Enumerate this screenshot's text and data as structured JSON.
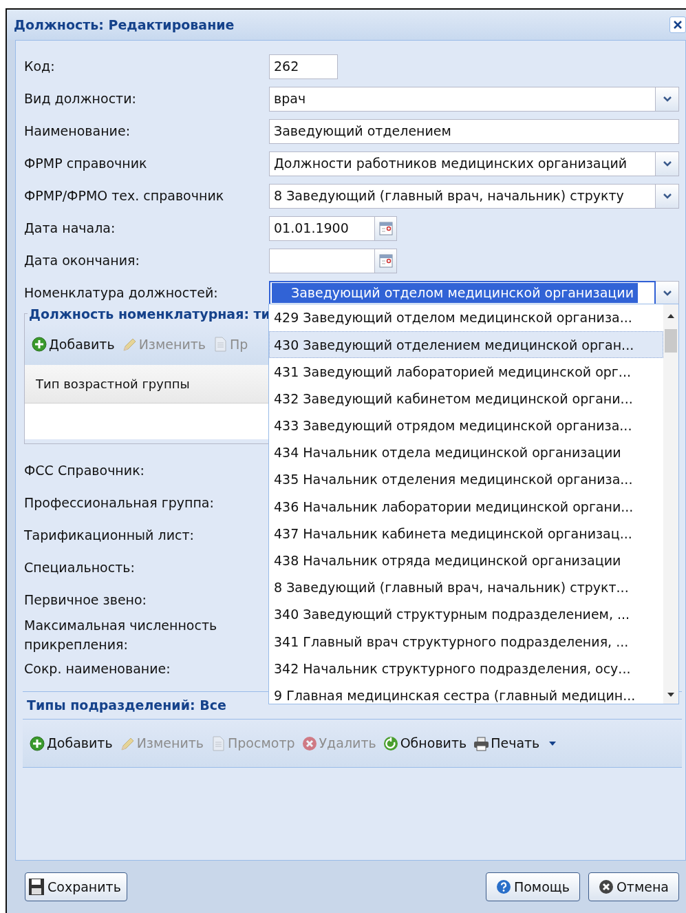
{
  "dialog": {
    "title": "Должность: Редактирование"
  },
  "fields": [
    {
      "label": "Код:",
      "kind": "short_text",
      "value": "262",
      "focused": false
    },
    {
      "label": "Вид должности:",
      "kind": "combo",
      "value": "врач",
      "focused": false
    },
    {
      "label": "Наименование:",
      "kind": "text",
      "value": "Заведующий отделением",
      "focused": false
    },
    {
      "label": "ФРМР справочник",
      "kind": "combo",
      "value": "Должности работников медицинских организаций",
      "focused": false
    },
    {
      "label": "ФРМР/ФРМО тех. справочник",
      "kind": "combo",
      "value": "8 Заведующий (главный врач, начальник) структу",
      "focused": false
    },
    {
      "label": "Дата начала:",
      "kind": "date",
      "value": "01.01.1900",
      "focused": false
    },
    {
      "label": "Дата окончания:",
      "kind": "date",
      "focused": false
    },
    {
      "label": "Номенклатура должностей:",
      "kind": "combo",
      "value": "Заведующий отделом медицинской организации",
      "focused": true
    }
  ],
  "nomenclature_panel": {
    "title": "Должность номенклатурная: ти",
    "toolbar": [
      {
        "label": "Добавить",
        "kind": "add",
        "disabled": false
      },
      {
        "label": "Изменить",
        "kind": "edit",
        "disabled": true
      },
      {
        "label": "Пр",
        "kind": "view",
        "disabled": true
      }
    ],
    "columns": [
      "Тип возрастной группы"
    ]
  },
  "more_labels": [
    "ФСС Справочник:",
    "Профессиональная группа:",
    "Тарификационный лист:",
    "Специальность:",
    "Первичное звено:",
    "Максимальная численность прикрепления:",
    "Сокр. наименование:"
  ],
  "dropdown": {
    "items": [
      {
        "text": "429 Заведующий отделом медицинской организа...",
        "selected": false
      },
      {
        "text": "430 Заведующий отделением медицинской орган...",
        "selected": true
      },
      {
        "text": "431 Заведующий лабораторией медицинской орг...",
        "selected": false
      },
      {
        "text": "432 Заведующий кабинетом медицинской органи...",
        "selected": false
      },
      {
        "text": "433 Заведующий отрядом медицинской организа...",
        "selected": false
      },
      {
        "text": "434 Начальник отдела медицинской организации",
        "selected": false
      },
      {
        "text": "435 Начальник отделения медицинской организа...",
        "selected": false
      },
      {
        "text": "436 Начальник лаборатории медицинской органи...",
        "selected": false
      },
      {
        "text": "437 Начальник кабинета медицинской организац...",
        "selected": false
      },
      {
        "text": "438 Начальник отряда медицинской организации",
        "selected": false
      },
      {
        "text": "8 Заведующий (главный врач, начальник) структ...",
        "selected": false
      },
      {
        "text": "340 Заведующий структурным подразделением, ...",
        "selected": false
      },
      {
        "text": "341 Главный врач структурного подразделения, ...",
        "selected": false
      },
      {
        "text": "342 Начальник структурного подразделения, осу...",
        "selected": false
      },
      {
        "text": "9 Главная медицинская сестра (главный медицин...",
        "selected": false
      }
    ]
  },
  "units_panel": {
    "title": "Типы подразделений: Все",
    "toolbar": [
      {
        "label": "Добавить",
        "kind": "add",
        "disabled": false
      },
      {
        "label": "Изменить",
        "kind": "edit",
        "disabled": true
      },
      {
        "label": "Просмотр",
        "kind": "view",
        "disabled": true
      },
      {
        "label": "Удалить",
        "kind": "delete",
        "disabled": true
      },
      {
        "label": "Обновить",
        "kind": "refresh",
        "disabled": false
      },
      {
        "label": "Печать",
        "kind": "print",
        "disabled": false,
        "has_menu": true
      }
    ]
  },
  "footer": {
    "buttons": [
      {
        "label": "Сохранить",
        "kind": "save"
      },
      {
        "label": "Помощь",
        "kind": "help"
      },
      {
        "label": "Отмена",
        "kind": "cancel"
      }
    ]
  }
}
